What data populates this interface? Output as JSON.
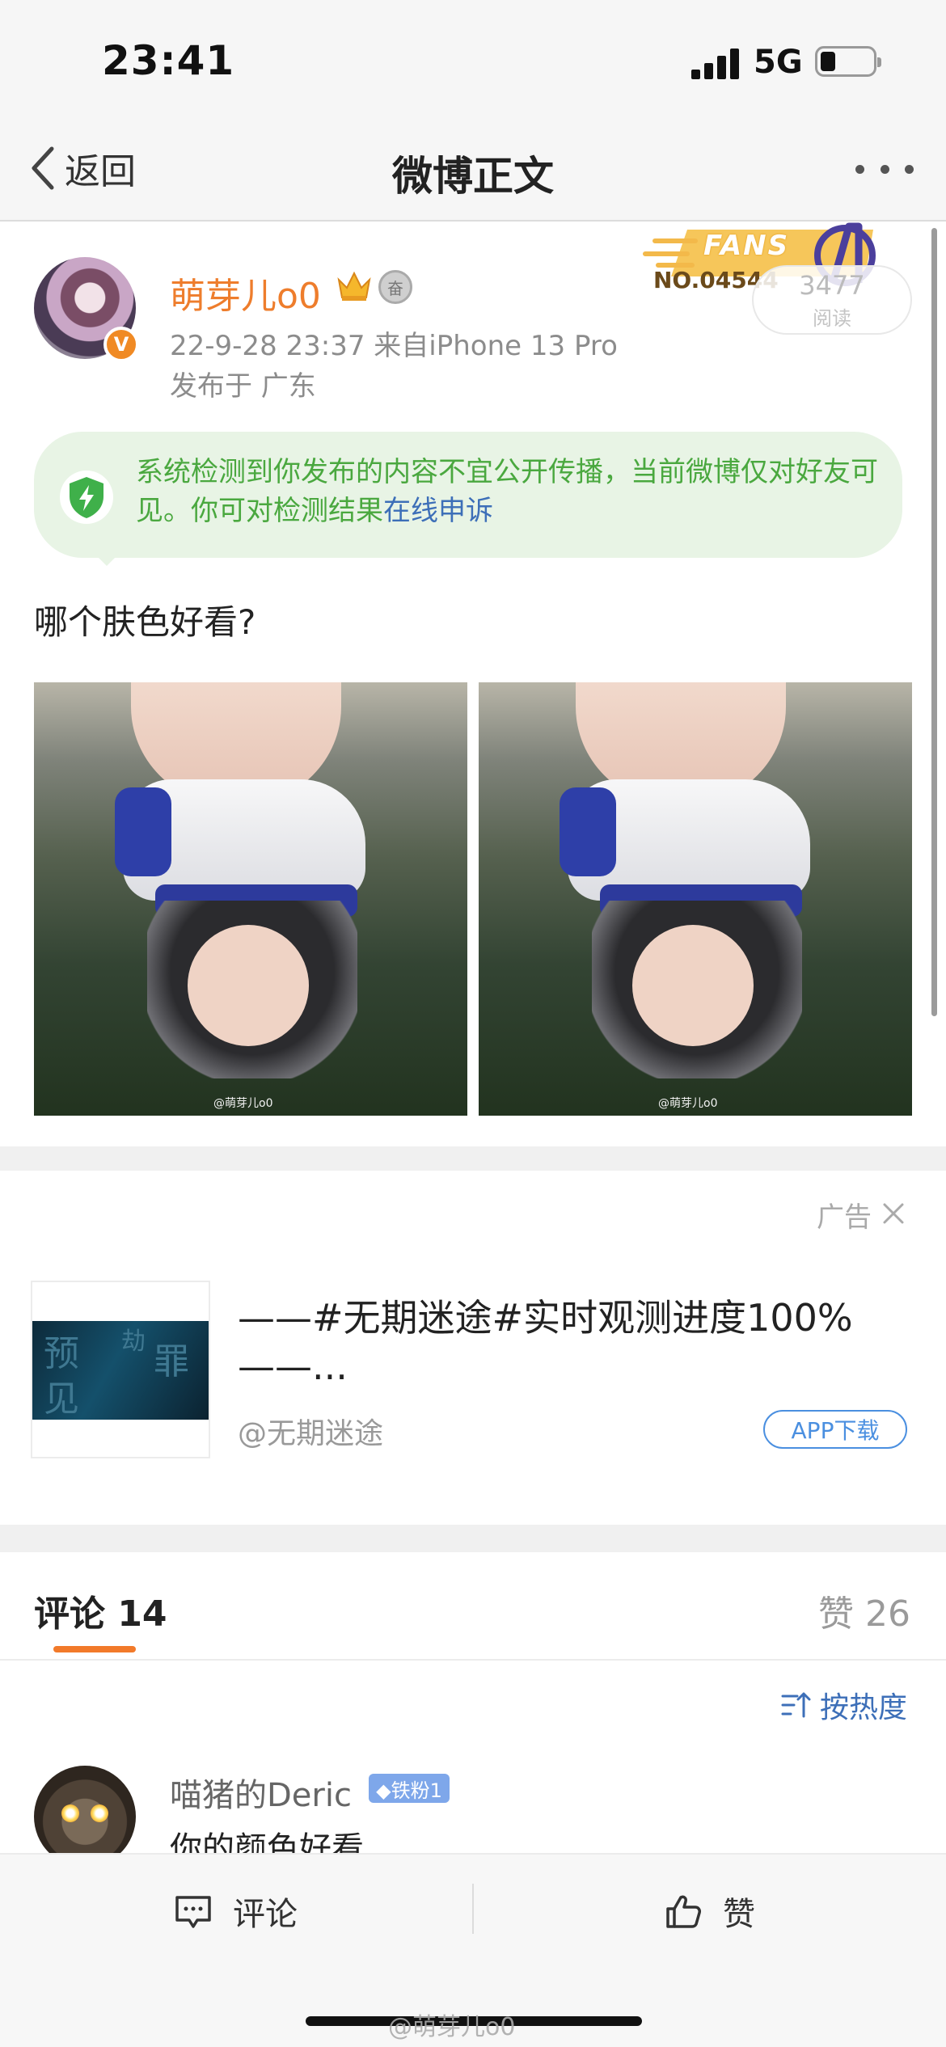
{
  "status_bar": {
    "time": "23:41",
    "network": "5G"
  },
  "nav": {
    "back_label": "返回",
    "title": "微博正文"
  },
  "post": {
    "author": "萌芽儿o0",
    "verified_mark": "V",
    "medal_text": "奋",
    "timestamp_source": "22-9-28 23:37  来自iPhone 13 Pro",
    "location": "发布于 广东",
    "fans_badge_label": "FANS",
    "fans_badge_number": "NO.04544",
    "read_count": "3477",
    "read_label": "阅读",
    "notice_text": "系统检测到你发布的内容不宜公开传播，当前微博仅对好友可见。你可对检测结果",
    "notice_link": "在线申诉",
    "text": "哪个肤色好看?",
    "image_watermark": "@萌芽儿o0"
  },
  "ad": {
    "label": "广告",
    "title": "——#无期迷途#实时观测进度100%——...",
    "source": "@无期迷途",
    "button": "APP下载"
  },
  "tabs": {
    "comments_label": "评论 14",
    "likes_label": "赞 26"
  },
  "sort": {
    "label": "按热度"
  },
  "comments": [
    {
      "user": "喵猪的Deric",
      "badge": "◆铁粉1",
      "text": "你的颜色好看"
    }
  ],
  "toolbar": {
    "comment_label": "评论",
    "like_label": "赞"
  },
  "watermark": "@萌芽儿o0",
  "colors": {
    "accent_orange": "#f27a2a",
    "link_blue": "#3d6fb8",
    "notice_green": "#4aa83f",
    "notice_bg": "#e8f4e5"
  }
}
